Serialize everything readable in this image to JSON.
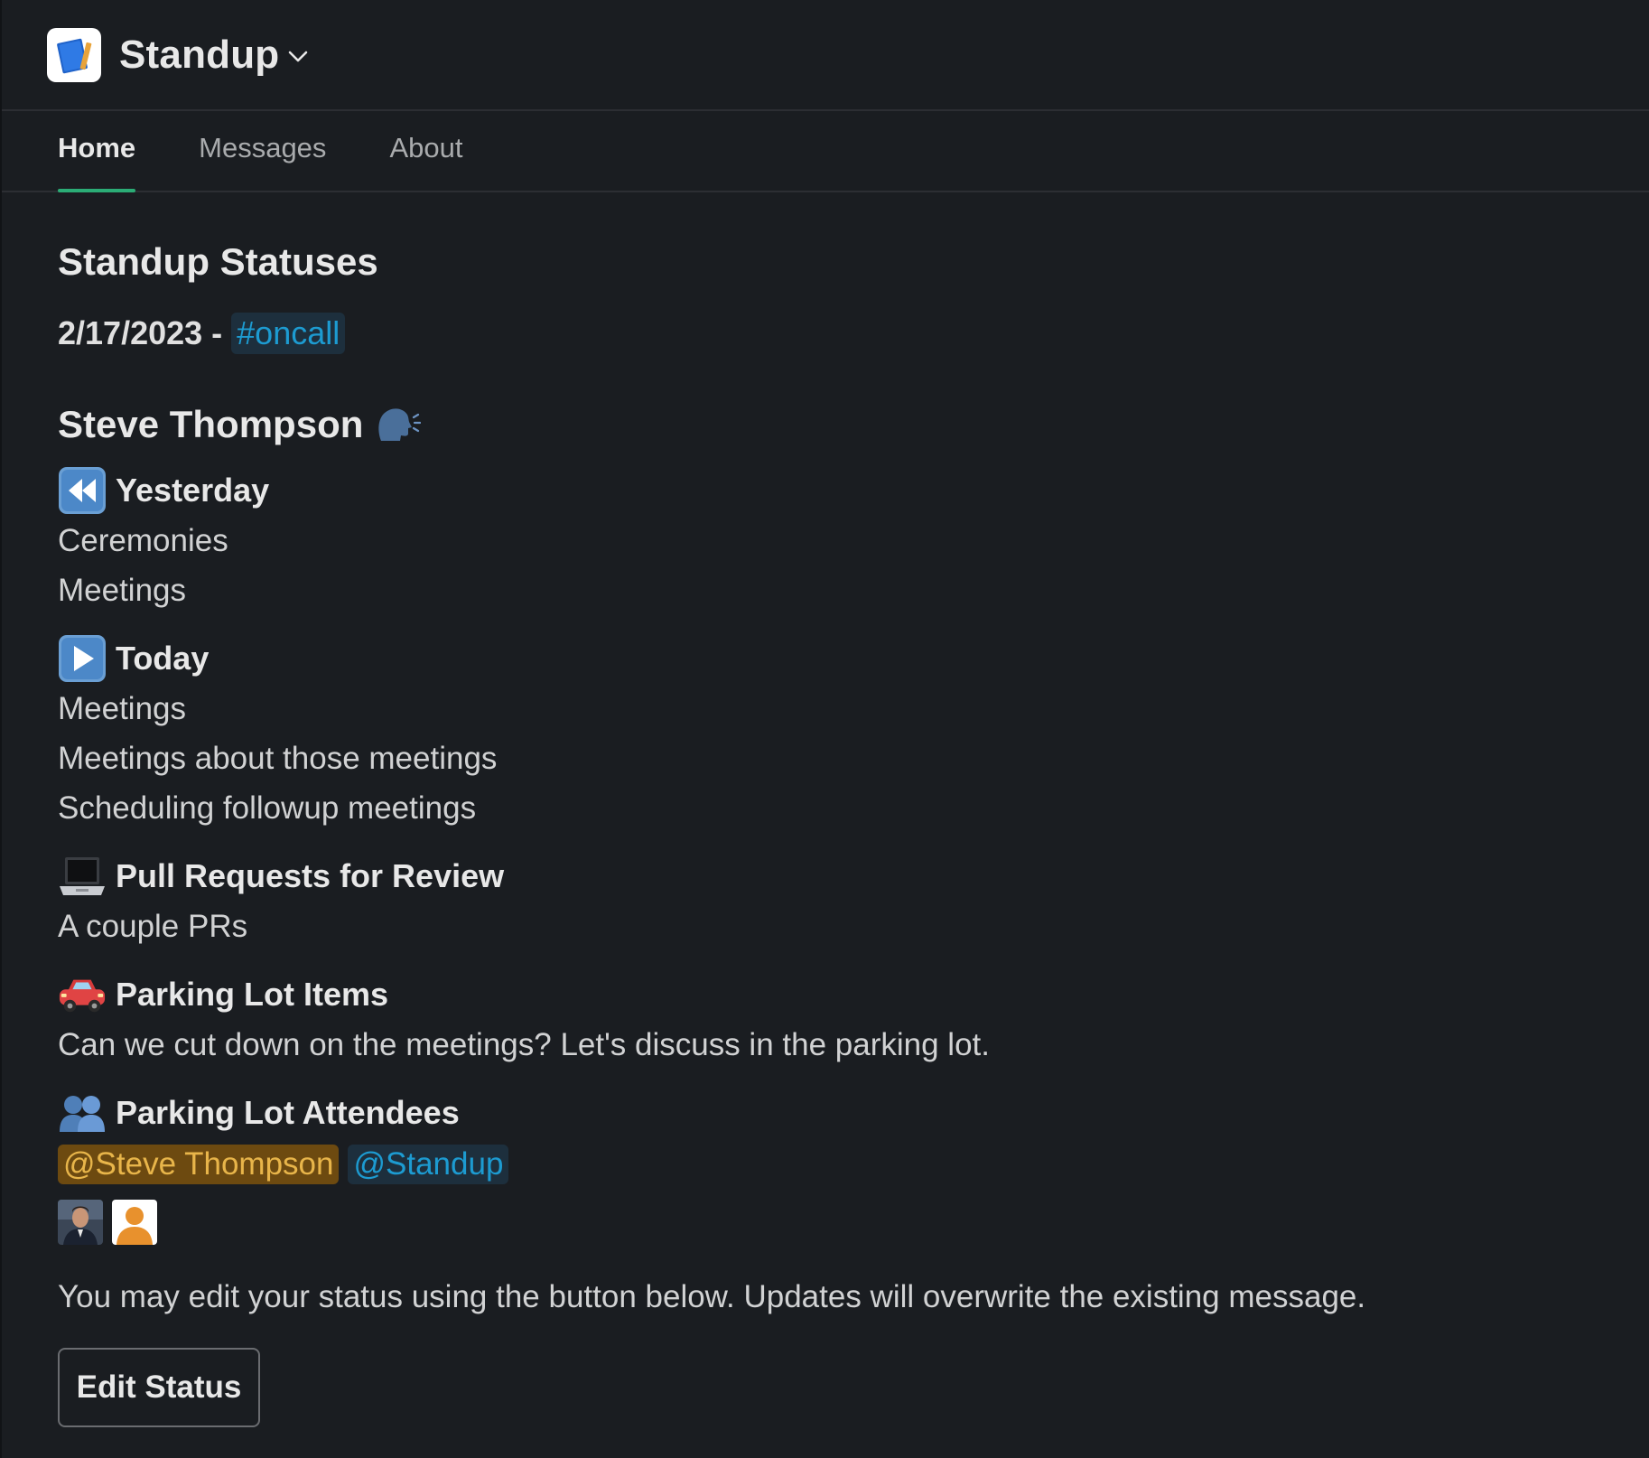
{
  "app": {
    "title": "Standup"
  },
  "tabs": [
    {
      "label": "Home",
      "active": true
    },
    {
      "label": "Messages",
      "active": false
    },
    {
      "label": "About",
      "active": false
    }
  ],
  "main": {
    "title": "Standup Statuses",
    "date": "2/17/2023 -",
    "channel": "#oncall",
    "user_name": "Steve Thompson",
    "sections": {
      "yesterday": {
        "heading": "Yesterday",
        "icon": "rewind-icon",
        "items": [
          "Ceremonies",
          "Meetings"
        ]
      },
      "today": {
        "heading": "Today",
        "icon": "play-icon",
        "items": [
          "Meetings",
          "Meetings about those meetings",
          "Scheduling followup meetings"
        ]
      },
      "pull_requests": {
        "heading": "Pull Requests for Review",
        "icon": "laptop-icon",
        "items": [
          "A couple PRs"
        ]
      },
      "parking_lot": {
        "heading": "Parking Lot Items",
        "icon": "car-icon",
        "items": [
          "Can we cut down on the meetings? Let's discuss in the parking lot."
        ]
      },
      "attendees": {
        "heading": "Parking Lot Attendees",
        "icon": "people-icon",
        "mentions": [
          "@Steve Thompson",
          "@Standup"
        ]
      }
    },
    "note": "You may edit your status using the button below. Updates will overwrite the existing message.",
    "edit_button": "Edit Status"
  },
  "colors": {
    "background": "#1a1d21",
    "active_tab_underline": "#2bac76",
    "channel_link": "#1d9bd1",
    "self_mention_bg": "#6d4a10",
    "self_mention_text": "#e8b54a"
  }
}
